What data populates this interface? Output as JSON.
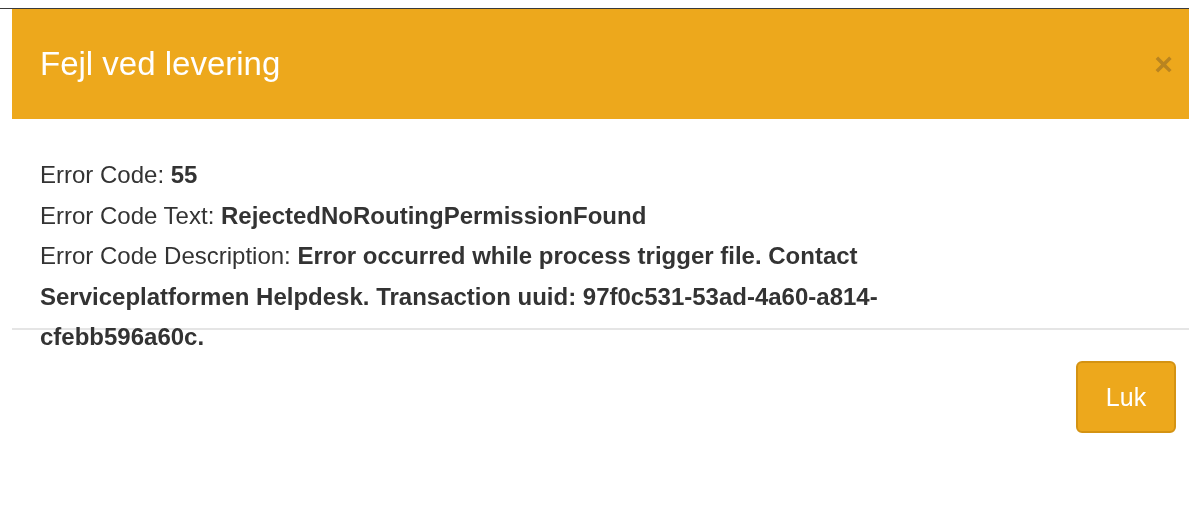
{
  "dialog": {
    "title": "Fejl ved levering",
    "close": "×",
    "lines": [
      "Error Code: **55**",
      "Error Code Text: **RejectedNoRoutingPermissionFound**",
      "Error Code Description: **Error occurred while process trigger file. Contact Serviceplatformen Helpdesk. Transaction uuid: 97f0c531-53ad-4a60-a814-cfebb596a60c.**"
    ],
    "buttons": [
      "Luk"
    ]
  }
}
